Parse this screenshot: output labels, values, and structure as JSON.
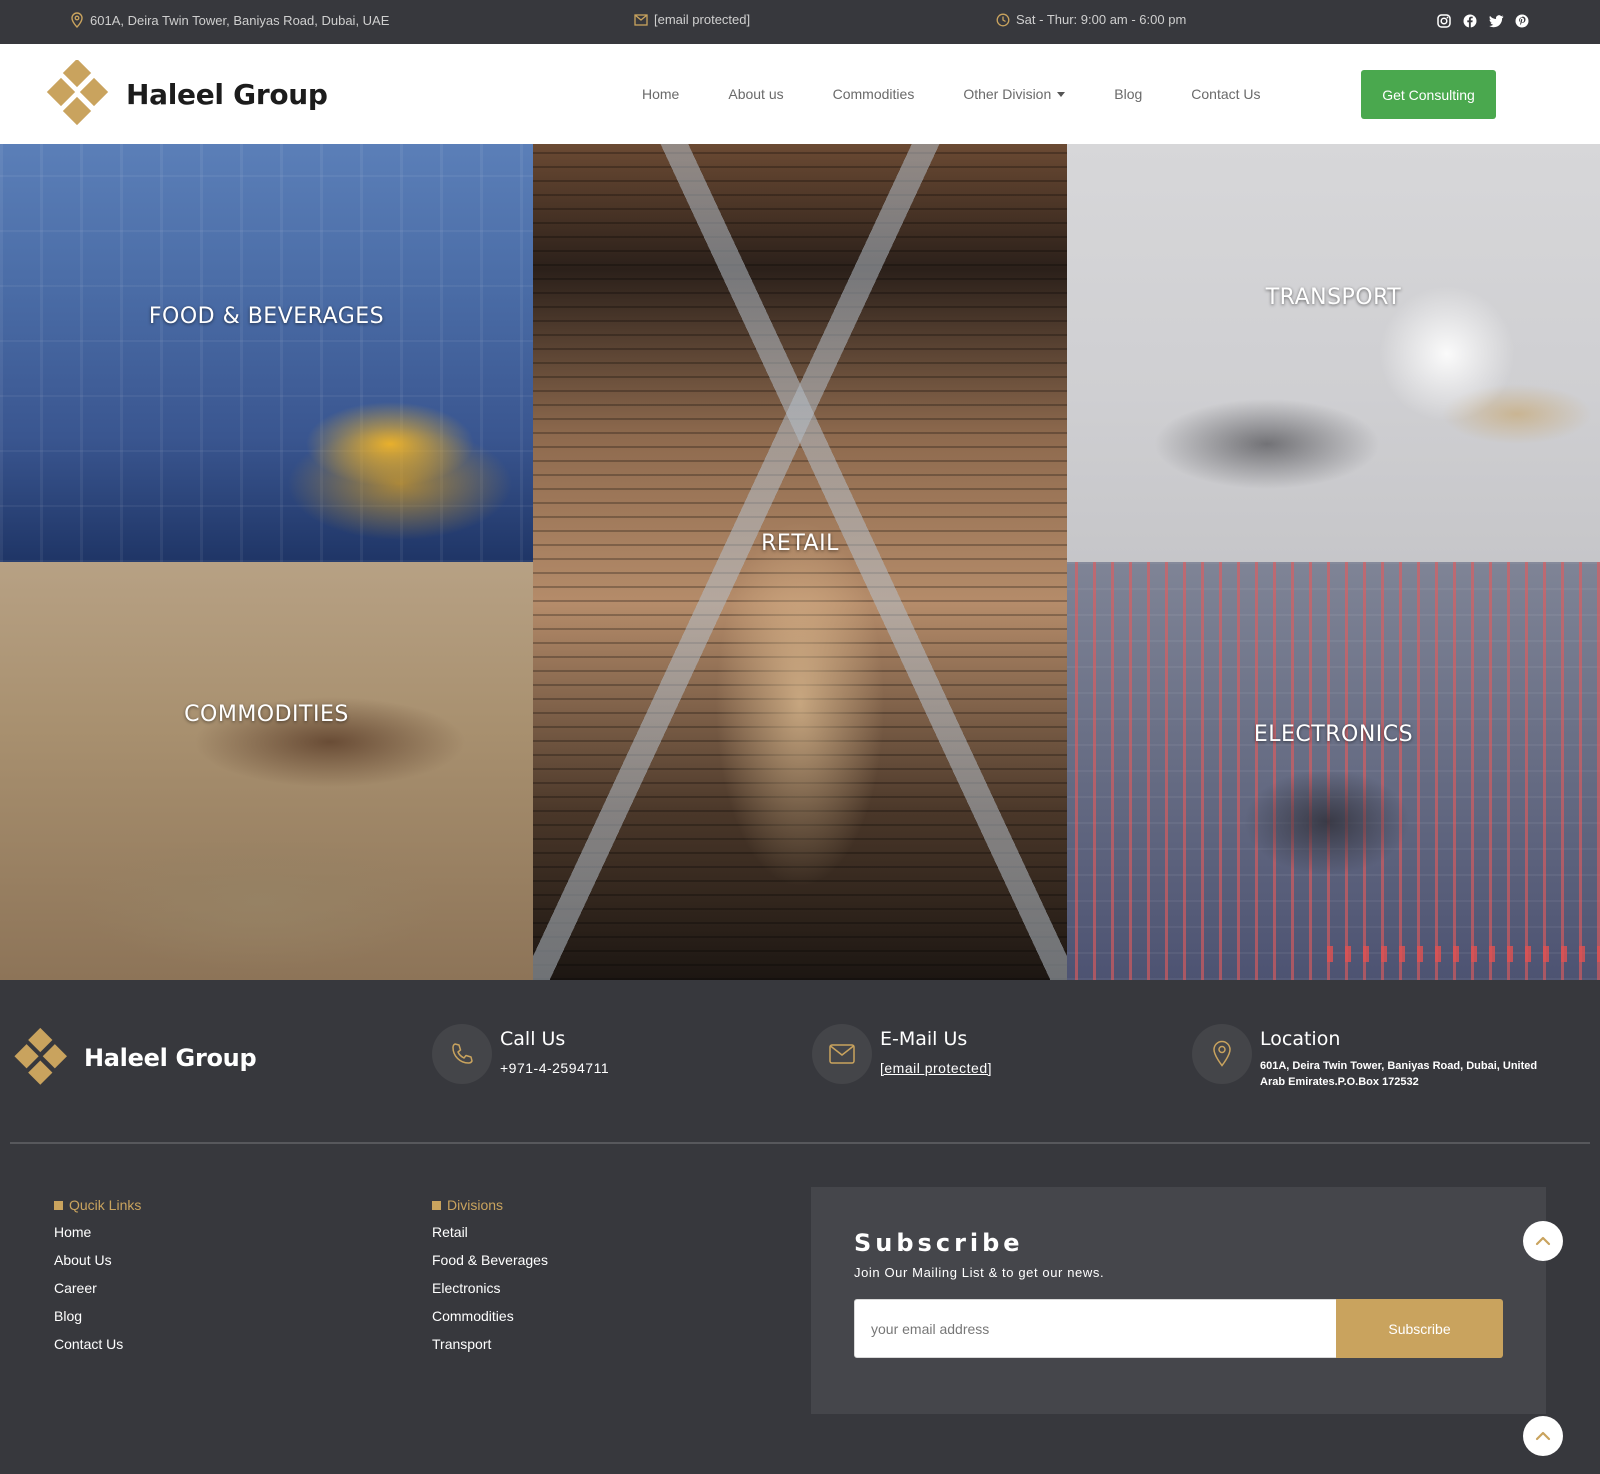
{
  "topbar": {
    "address": "601A, Deira Twin Tower, Baniyas Road, Dubai, UAE",
    "email": "[email protected]",
    "hours": "Sat - Thur: 9:00 am - 6:00 pm",
    "social_icons": [
      "instagram-icon",
      "facebook-icon",
      "twitter-icon",
      "pinterest-icon"
    ]
  },
  "header": {
    "brand": "Haleel Group",
    "nav": [
      "Home",
      "About us",
      "Commodities",
      "Other Division",
      "Blog",
      "Contact Us"
    ],
    "cta": "Get Consulting"
  },
  "divisions": {
    "food": "FOOD & BEVERAGES",
    "retail": "RETAIL",
    "transport": "TRANSPORT",
    "commodities": "COMMODITIES",
    "electronics": "ELECTRONICS"
  },
  "footer": {
    "brand": "Haleel Group",
    "call": {
      "title": "Call Us",
      "value": "+971-4-2594711"
    },
    "mail": {
      "title": "E-Mail Us",
      "value": "[email protected]"
    },
    "location": {
      "title": "Location",
      "value": "601A, Deira Twin Tower, Baniyas Road, Dubai, United Arab Emirates.P.O.Box 172532"
    },
    "quick_links": {
      "heading": "Qucik Links",
      "items": [
        "Home",
        "About Us",
        "Career",
        "Blog",
        "Contact Us"
      ]
    },
    "divisions": {
      "heading": "Divisions",
      "items": [
        "Retail",
        "Food & Beverages",
        "Electronics",
        "Commodities",
        "Transport"
      ]
    },
    "subscribe": {
      "title": "Subscribe",
      "subtitle": "Join Our Mailing List & to get our news.",
      "placeholder": "your email address",
      "button": "Subscribe"
    }
  },
  "colors": {
    "accent_gold": "#c9a35e",
    "cta_green": "#4aa84e",
    "dark_bg": "#37383d"
  }
}
